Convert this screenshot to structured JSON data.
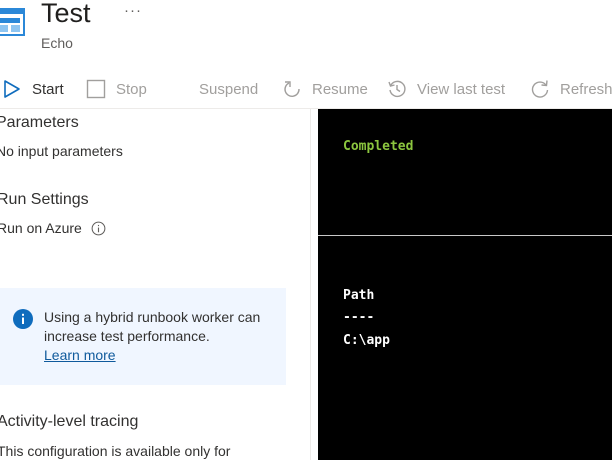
{
  "header": {
    "title": "Test",
    "subtitle": "Echo",
    "more": "···"
  },
  "toolbar": {
    "start": "Start",
    "stop": "Stop",
    "suspend": "Suspend",
    "resume": "Resume",
    "view_last_test": "View last test",
    "refresh": "Refresh"
  },
  "left": {
    "parameters_heading": "Parameters",
    "parameters_value": "No input parameters",
    "run_settings_heading": "Run Settings",
    "run_settings_value": "Run on Azure",
    "info_message": "Using a hybrid runbook worker can increase test performance.",
    "info_link": "Learn more",
    "tracing_heading": "Activity-level tracing",
    "tracing_text": "This configuration is available only for"
  },
  "console": {
    "status": "Completed",
    "output_lines": [
      "Path",
      "----",
      "C:\\app"
    ]
  },
  "colors": {
    "accent": "#0f6cbd",
    "status_green": "#8cc63f",
    "console_bg": "#000000",
    "info_bg": "#f0f6ff"
  },
  "icons": {
    "header": "runbook-test-icon",
    "start": "play-icon",
    "stop": "stop-icon",
    "resume": "resume-icon",
    "view_last": "history-icon",
    "refresh": "refresh-icon",
    "info": "info-icon"
  }
}
